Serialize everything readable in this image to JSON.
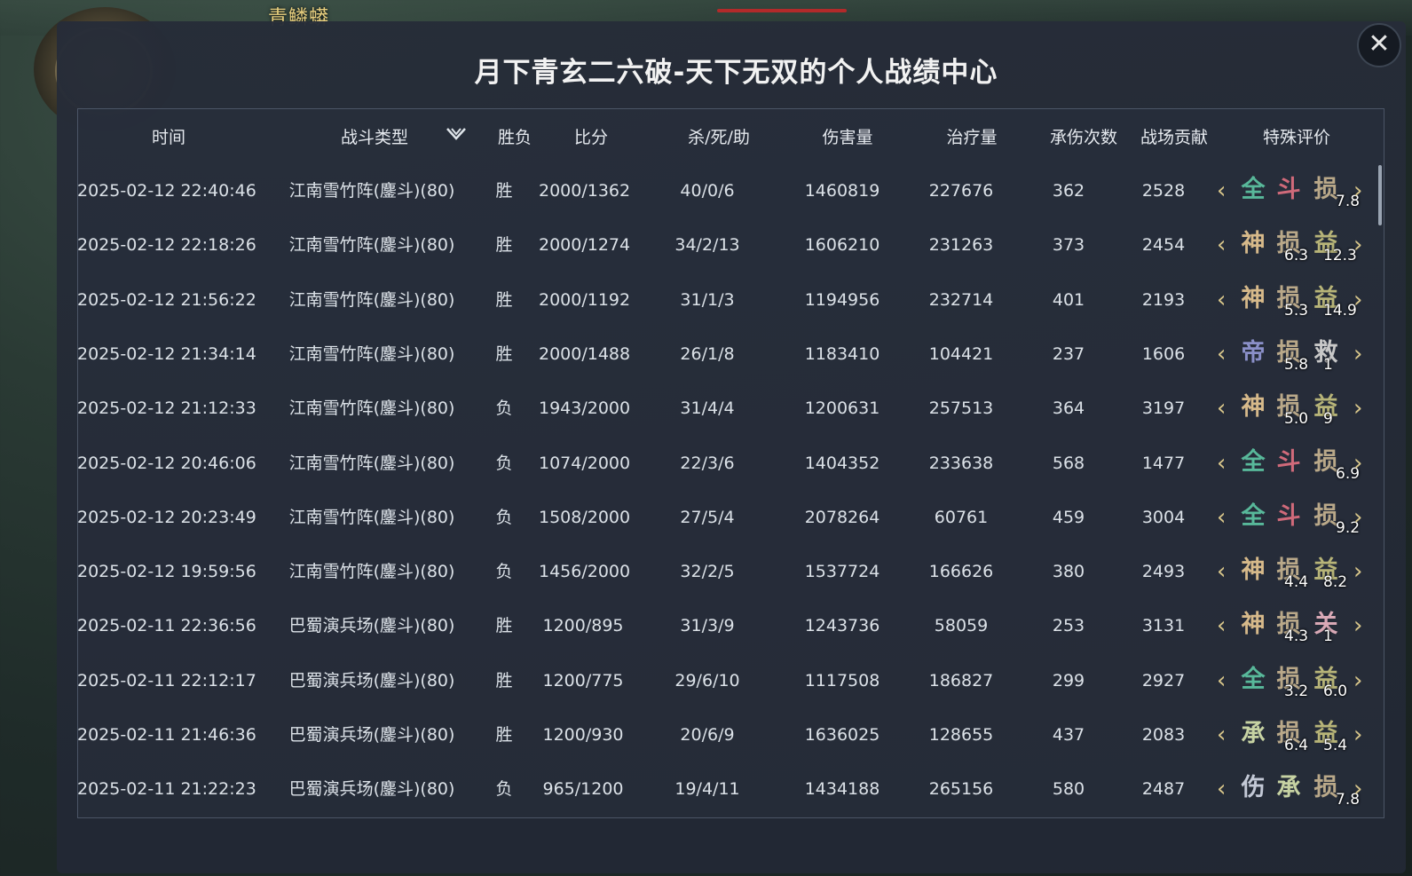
{
  "npc_name": "青鳞蟒",
  "title": "月下青玄二六破-天下无双的个人战绩中心",
  "close_label": "✕",
  "headers": [
    "时间",
    "战斗类型",
    "胜负",
    "比分",
    "杀/死/助",
    "伤害量",
    "治疗量",
    "承伤次数",
    "战场贡献",
    "特殊评价"
  ],
  "colors": {
    "全": "#58b89a",
    "斗": "#d06a7a",
    "损": "#b9a889",
    "神": "#d6b98a",
    "益": "#b7b478",
    "帝": "#8a8fc8",
    "救": "#c8c8c8",
    "关": "#d9a9b6",
    "承": "#c7d3a3",
    "伤": "#c3c9d6"
  },
  "rows": [
    {
      "time": "2025-02-12 22:40:46",
      "type": "江南雪竹阵(鏖斗)(80)",
      "result": "胜",
      "score": "2000/1362",
      "kda": "40/0/6",
      "damage": "1460819",
      "heal": "227676",
      "hits": "362",
      "contrib": "2528",
      "badges": [
        "全",
        "斗",
        "损"
      ],
      "nums": [
        "7.8"
      ]
    },
    {
      "time": "2025-02-12 22:18:26",
      "type": "江南雪竹阵(鏖斗)(80)",
      "result": "胜",
      "score": "2000/1274",
      "kda": "34/2/13",
      "damage": "1606210",
      "heal": "231263",
      "hits": "373",
      "contrib": "2454",
      "badges": [
        "神",
        "损",
        "益"
      ],
      "nums": [
        "6.3",
        "12.3"
      ]
    },
    {
      "time": "2025-02-12 21:56:22",
      "type": "江南雪竹阵(鏖斗)(80)",
      "result": "胜",
      "score": "2000/1192",
      "kda": "31/1/3",
      "damage": "1194956",
      "heal": "232714",
      "hits": "401",
      "contrib": "2193",
      "badges": [
        "神",
        "损",
        "益"
      ],
      "nums": [
        "5.3",
        "14.9"
      ]
    },
    {
      "time": "2025-02-12 21:34:14",
      "type": "江南雪竹阵(鏖斗)(80)",
      "result": "胜",
      "score": "2000/1488",
      "kda": "26/1/8",
      "damage": "1183410",
      "heal": "104421",
      "hits": "237",
      "contrib": "1606",
      "badges": [
        "帝",
        "损",
        "救"
      ],
      "nums": [
        "5.8",
        "1"
      ]
    },
    {
      "time": "2025-02-12 21:12:33",
      "type": "江南雪竹阵(鏖斗)(80)",
      "result": "负",
      "score": "1943/2000",
      "kda": "31/4/4",
      "damage": "1200631",
      "heal": "257513",
      "hits": "364",
      "contrib": "3197",
      "badges": [
        "神",
        "损",
        "益"
      ],
      "nums": [
        "5.0",
        "9"
      ]
    },
    {
      "time": "2025-02-12 20:46:06",
      "type": "江南雪竹阵(鏖斗)(80)",
      "result": "负",
      "score": "1074/2000",
      "kda": "22/3/6",
      "damage": "1404352",
      "heal": "233638",
      "hits": "568",
      "contrib": "1477",
      "badges": [
        "全",
        "斗",
        "损"
      ],
      "nums": [
        "6.9"
      ]
    },
    {
      "time": "2025-02-12 20:23:49",
      "type": "江南雪竹阵(鏖斗)(80)",
      "result": "负",
      "score": "1508/2000",
      "kda": "27/5/4",
      "damage": "2078264",
      "heal": "60761",
      "hits": "459",
      "contrib": "3004",
      "badges": [
        "全",
        "斗",
        "损"
      ],
      "nums": [
        "9.2"
      ]
    },
    {
      "time": "2025-02-12 19:59:56",
      "type": "江南雪竹阵(鏖斗)(80)",
      "result": "负",
      "score": "1456/2000",
      "kda": "32/2/5",
      "damage": "1537724",
      "heal": "166626",
      "hits": "380",
      "contrib": "2493",
      "badges": [
        "神",
        "损",
        "益"
      ],
      "nums": [
        "4.4",
        "8.2"
      ]
    },
    {
      "time": "2025-02-11 22:36:56",
      "type": "巴蜀演兵场(鏖斗)(80)",
      "result": "胜",
      "score": "1200/895",
      "kda": "31/3/9",
      "damage": "1243736",
      "heal": "58059",
      "hits": "253",
      "contrib": "3131",
      "badges": [
        "神",
        "损",
        "关"
      ],
      "nums": [
        "4.3",
        "1"
      ]
    },
    {
      "time": "2025-02-11 22:12:17",
      "type": "巴蜀演兵场(鏖斗)(80)",
      "result": "胜",
      "score": "1200/775",
      "kda": "29/6/10",
      "damage": "1117508",
      "heal": "186827",
      "hits": "299",
      "contrib": "2927",
      "badges": [
        "全",
        "损",
        "益"
      ],
      "nums": [
        "3.2",
        "6.0"
      ]
    },
    {
      "time": "2025-02-11 21:46:36",
      "type": "巴蜀演兵场(鏖斗)(80)",
      "result": "胜",
      "score": "1200/930",
      "kda": "20/6/9",
      "damage": "1636025",
      "heal": "128655",
      "hits": "437",
      "contrib": "2083",
      "badges": [
        "承",
        "损",
        "益"
      ],
      "nums": [
        "6.4",
        "5.4"
      ]
    },
    {
      "time": "2025-02-11 21:22:23",
      "type": "巴蜀演兵场(鏖斗)(80)",
      "result": "负",
      "score": "965/1200",
      "kda": "19/4/11",
      "damage": "1434188",
      "heal": "265156",
      "hits": "580",
      "contrib": "2487",
      "badges": [
        "伤",
        "承",
        "损"
      ],
      "nums": [
        "7.8"
      ]
    }
  ]
}
